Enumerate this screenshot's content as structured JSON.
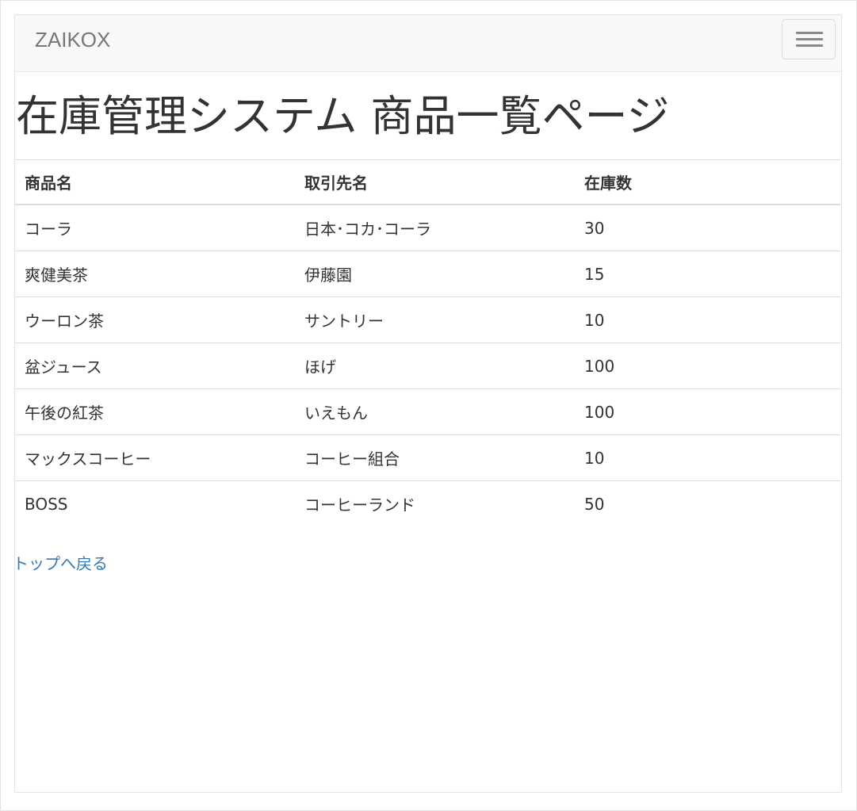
{
  "navbar": {
    "brand": "ZAIKOX",
    "toggle_icon": "hamburger-menu-icon"
  },
  "page_title": "在庫管理システム 商品一覧ページ",
  "table": {
    "headers": [
      "商品名",
      "取引先名",
      "在庫数"
    ],
    "rows": [
      [
        "コーラ",
        "日本･コカ･コーラ",
        "30"
      ],
      [
        "爽健美茶",
        "伊藤園",
        "15"
      ],
      [
        "ウーロン茶",
        "サントリー",
        "10"
      ],
      [
        "盆ジュース",
        "ほげ",
        "100"
      ],
      [
        "午後の紅茶",
        "いえもん",
        "100"
      ],
      [
        "マックスコーヒー",
        "コーヒー組合",
        "10"
      ],
      [
        "BOSS",
        "コーヒーランド",
        "50"
      ]
    ]
  },
  "back_link": "トップへ戻る",
  "colors": {
    "link": "#337ab7",
    "navbar_bg": "#f8f8f8",
    "brand": "#777777"
  }
}
